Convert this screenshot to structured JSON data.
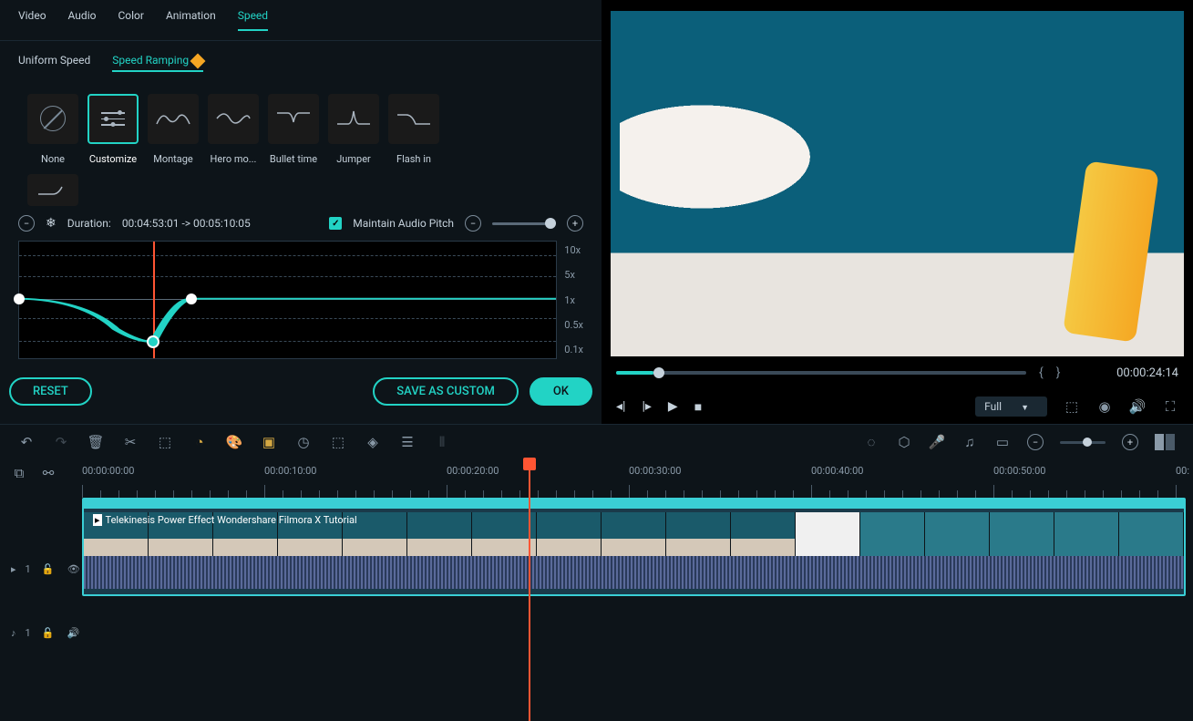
{
  "tabs": {
    "video": "Video",
    "audio": "Audio",
    "color": "Color",
    "animation": "Animation",
    "speed": "Speed"
  },
  "subtabs": {
    "uniform": "Uniform Speed",
    "ramping": "Speed Ramping"
  },
  "presets": {
    "none": "None",
    "customize": "Customize",
    "montage": "Montage",
    "hero": "Hero mo...",
    "bullet": "Bullet time",
    "jumper": "Jumper",
    "flash": "Flash in"
  },
  "duration": {
    "label": "Duration:",
    "value": "00:04:53:01 -> 00:05:10:05"
  },
  "maintain_pitch": "Maintain Audio Pitch",
  "speed_labels": {
    "l10": "10x",
    "l5": "5x",
    "l1": "1x",
    "l05": "0.5x",
    "l01": "0.1x"
  },
  "buttons": {
    "reset": "RESET",
    "save_custom": "SAVE AS CUSTOM",
    "ok": "OK"
  },
  "preview": {
    "timecode": "00:00:24:14",
    "quality": "Full"
  },
  "ruler": {
    "t0": "00:00:00:00",
    "t10": "00:00:10:00",
    "t20": "00:00:20:00",
    "t30": "00:00:30:00",
    "t40": "00:00:40:00",
    "t50": "00:00:50:00",
    "t60": "00:"
  },
  "tracks": {
    "video": "1",
    "audio": "1"
  },
  "clip": {
    "title": "Telekinesis Power Effect   Wondershare Filmora X  Tutorial"
  }
}
